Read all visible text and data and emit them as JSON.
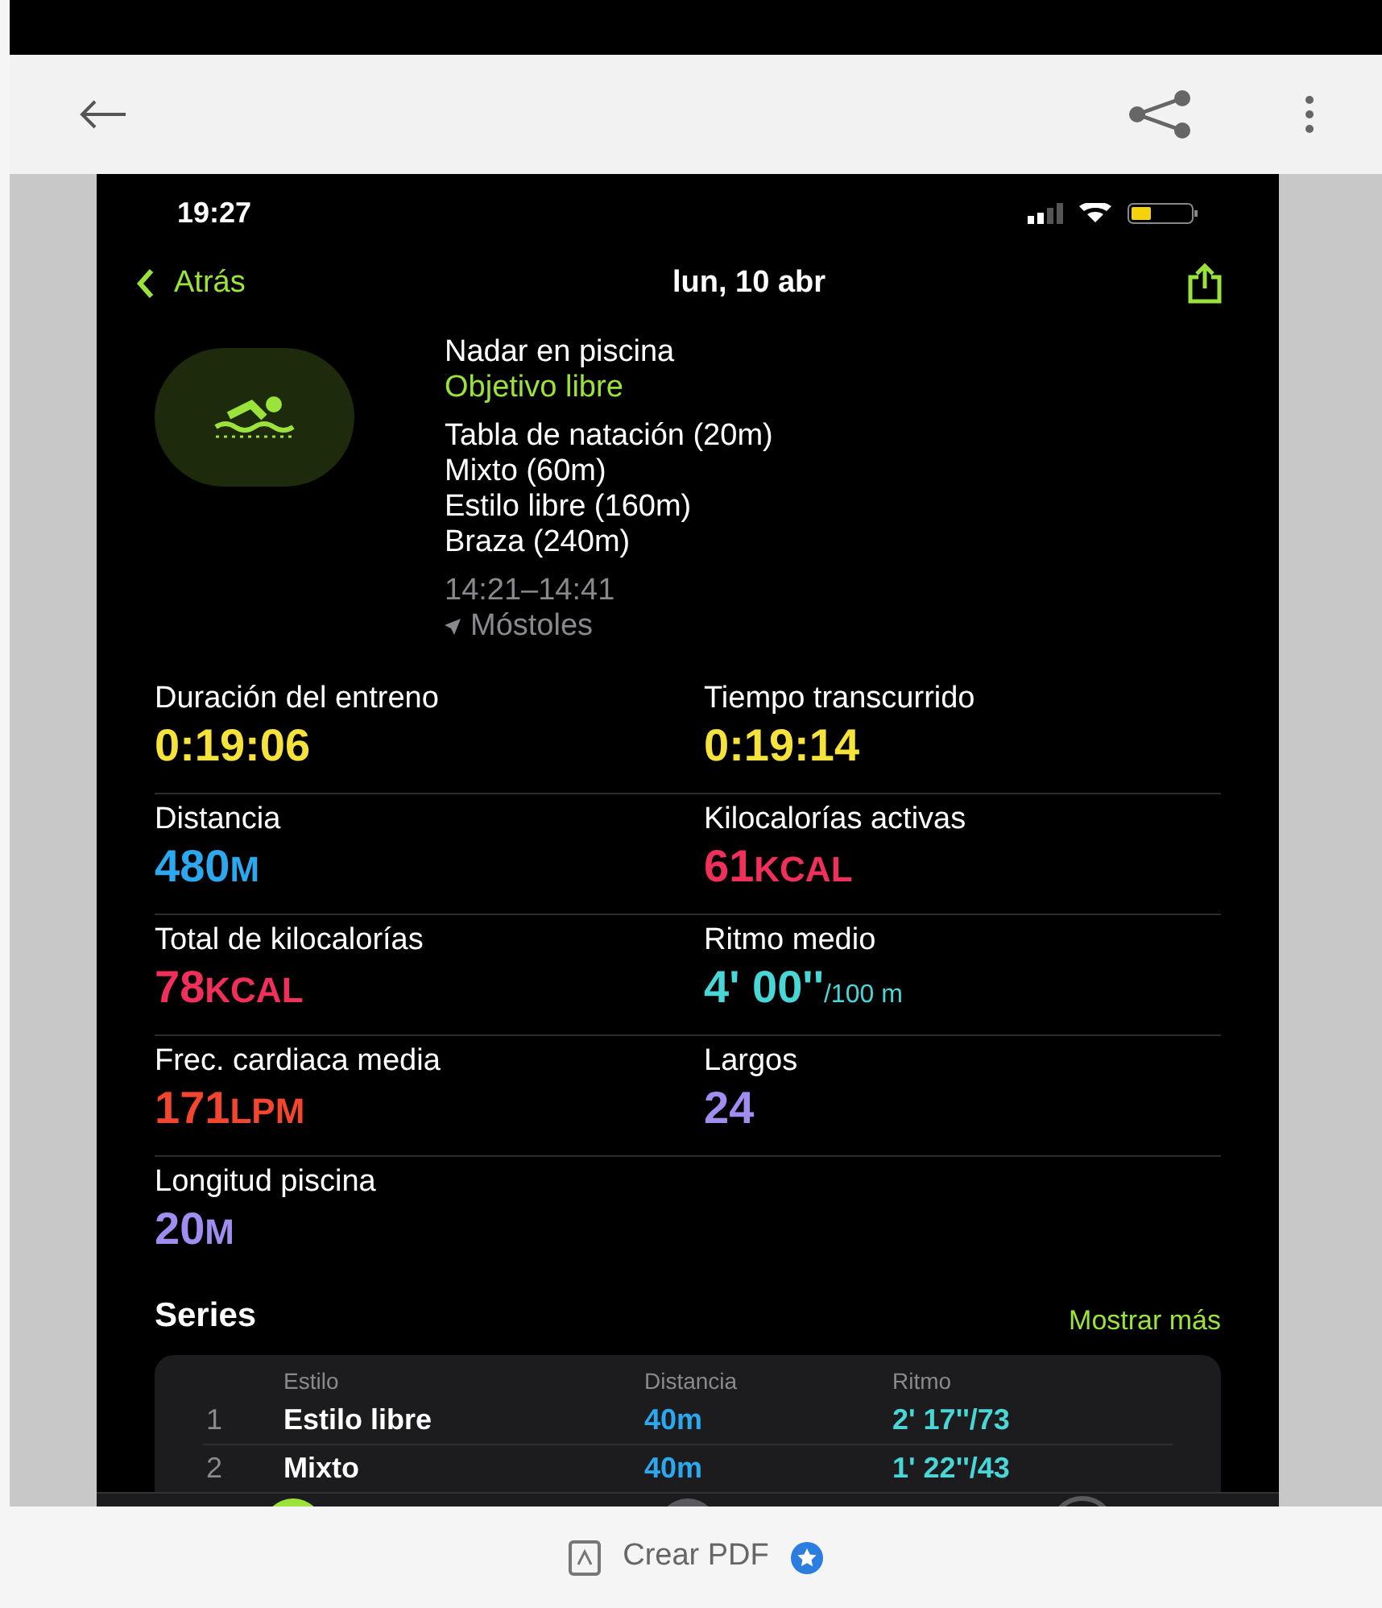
{
  "phone": {
    "time": "19:27",
    "back": "Atrás",
    "date": "lun, 10 abr"
  },
  "workout": {
    "title": "Nadar en piscina",
    "goal": "Objetivo libre",
    "strokes": [
      "Tabla de natación (20m)",
      "Mixto (60m)",
      "Estilo libre (160m)",
      "Braza (240m)"
    ],
    "time_range": "14:21–14:41",
    "location": "Móstoles"
  },
  "metrics": [
    {
      "label": "Duración del entreno",
      "value": "0:19:06",
      "color": "#f5e23a"
    },
    {
      "label": "Tiempo transcurrido",
      "value": "0:19:14",
      "color": "#f5e23a"
    },
    {
      "label": "Distancia",
      "value": "480",
      "unit": "M",
      "color": "#2ca8ee"
    },
    {
      "label": "Kilocalorías activas",
      "value": "61",
      "unit": "KCAL",
      "color": "#f0305a"
    },
    {
      "label": "Total de kilocalorías",
      "value": "78",
      "unit": "KCAL",
      "color": "#f0305a"
    },
    {
      "label": "Ritmo medio",
      "value": "4' 00''",
      "unit": "/100 m",
      "color": "#48d6d6"
    },
    {
      "label": "Frec. cardiaca media",
      "value": "171",
      "unit": "LPM",
      "color": "#f4452e"
    },
    {
      "label": "Largos",
      "value": "24",
      "color": "#a18df0"
    },
    {
      "label": "Longitud piscina",
      "value": "20",
      "unit": "M",
      "color": "#a18df0"
    }
  ],
  "series": {
    "title": "Series",
    "more": "Mostrar más",
    "columns": [
      "Estilo",
      "Distancia",
      "Ritmo"
    ],
    "rows": [
      {
        "n": "1",
        "style": "Estilo libre",
        "distance": "40m",
        "pace": "2' 17''/73"
      },
      {
        "n": "2",
        "style": "Mixto",
        "distance": "40m",
        "pace": "1' 22''/43"
      }
    ]
  },
  "bottom_bar": {
    "label": "Crear PDF"
  }
}
